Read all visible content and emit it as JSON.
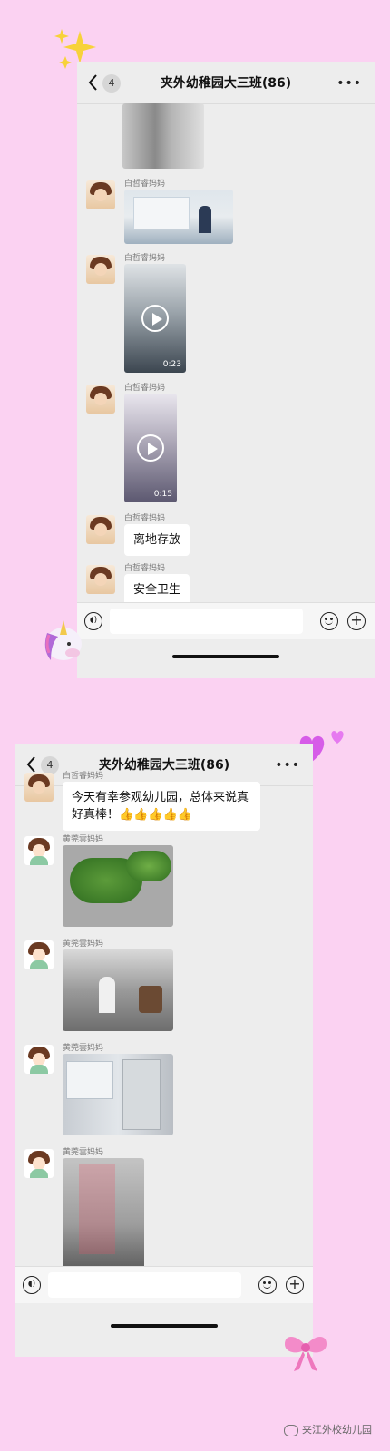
{
  "chat1": {
    "title": "夹外幼稚园大三班(86)",
    "unread": "4",
    "messages": [
      {
        "sender": "白哲睿妈妈",
        "type": "video",
        "duration": "0:23"
      },
      {
        "sender": "白哲睿妈妈",
        "type": "video",
        "duration": "0:15"
      },
      {
        "sender": "白哲睿妈妈",
        "type": "text",
        "text": "离地存放"
      },
      {
        "sender": "白哲睿妈妈",
        "type": "text",
        "text": "安全卫生"
      }
    ],
    "image_sender": "白哲睿妈妈"
  },
  "chat2": {
    "title": "夹外幼稚园大三班(86)",
    "unread": "4",
    "first_sender": "白哲睿妈妈",
    "first_text_line1": "今天有幸参观幼儿园，总体来说真",
    "first_text_line2": "好真棒！👍👍👍👍👍",
    "photo_sender": "黄莞雲妈妈"
  },
  "icons": [
    "chevron-left-icon",
    "more-icon",
    "voice-icon",
    "emoji-icon",
    "plus-icon",
    "play-icon",
    "sparkle-icon",
    "unicorn-icon",
    "heart-icon",
    "bow-icon"
  ],
  "watermark": "夹江外校幼儿园",
  "colors": {
    "background": "#fbd2f2",
    "chat_bg": "#ededed"
  }
}
